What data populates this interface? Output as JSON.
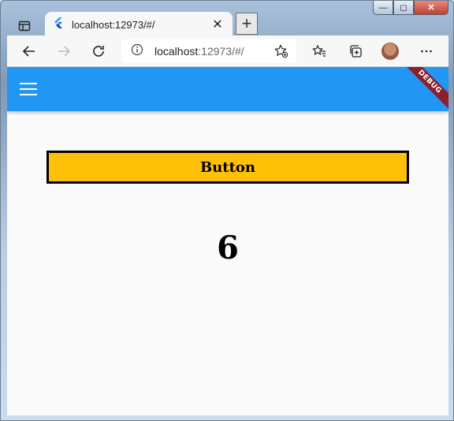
{
  "browser": {
    "tab": {
      "title": "localhost:12973/#/"
    },
    "address": {
      "host": "localhost",
      "rest": ":12973/#/"
    }
  },
  "app": {
    "debug_label": "DEBUG",
    "button_label": "Button",
    "counter_value": "6"
  }
}
